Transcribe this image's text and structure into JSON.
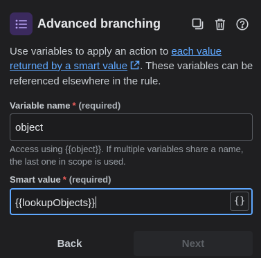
{
  "header": {
    "title": "Advanced branching",
    "icons": [
      "list-icon",
      "duplicate-icon",
      "trash-icon",
      "help-icon"
    ],
    "accent_bg": "#3b2a5e"
  },
  "description": {
    "text_before": "Use variables to apply an action to ",
    "link_text": "each value returned by a smart value",
    "text_after": ". These variables can be referenced elsewhere in the rule."
  },
  "variable_name": {
    "label": "Variable name",
    "required_mark": "*",
    "required_text": "(required)",
    "value": "object",
    "help": "Access using {{object}}. If multiple variables share a name, the last one in scope is used."
  },
  "smart_value": {
    "label": "Smart value",
    "required_mark": "*",
    "required_text": "(required)",
    "value": "{{lookupObjects}}",
    "insert_button": "{}"
  },
  "footer": {
    "back_label": "Back",
    "next_label": "Next"
  },
  "colors": {
    "background": "#1f1f21",
    "link": "#5fa8ff",
    "focus_border": "#5fa8ff",
    "required": "#f25f5c"
  }
}
